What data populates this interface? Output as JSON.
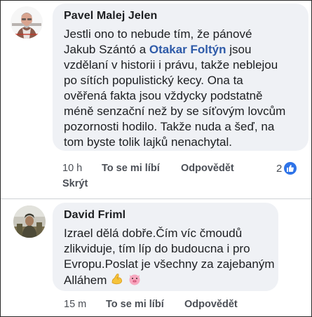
{
  "comments": [
    {
      "author": "Pavel Malej Jelen",
      "lines": [
        {
          "pre": "Jestli ono to nebude tím, že pánové"
        },
        {
          "pre": "Jakub Szántó a ",
          "mention": "Otakar Foltýn",
          "post": " jsou"
        },
        {
          "pre": "vzdělaní v historii i právu, takže neblejou"
        },
        {
          "pre": "po sítích populistický kecy. Ona ta"
        },
        {
          "pre": "ověřená fakta jsou vždycky podstatně"
        },
        {
          "pre": "méně senzační než by se síťovým lovcům"
        },
        {
          "pre": "pozornosti hodilo. Takže nuda a šeď, na"
        },
        {
          "pre": "tom byste tolik lajků nenachytal."
        }
      ],
      "time": "10 h",
      "like_label": "To se mi líbí",
      "reply_label": "Odpovědět",
      "hide_label": "Skrýt",
      "reaction_count": "2",
      "reaction_icon": "thumbs-up-icon"
    },
    {
      "author": "David Friml",
      "lines": [
        {
          "pre": "Izrael dělá dobře.Čím víc čmoudů"
        },
        {
          "pre": "zlikviduje, tím líp do budoucna i pro"
        },
        {
          "pre": "Evropu.Poslat je všechny za zajebaným"
        },
        {
          "pre": "Alláhem"
        }
      ],
      "emojis": [
        "flexed-biceps-icon",
        "pig-face-icon"
      ],
      "time": "15 m",
      "like_label": "To se mi líbí",
      "reply_label": "Odpovědět"
    }
  ],
  "colors": {
    "bubble": "#eff1f5",
    "text": "#1c1e21",
    "meta": "#4b4f56",
    "mention": "#2e5aa8",
    "like_blue": "#2e73e8"
  }
}
